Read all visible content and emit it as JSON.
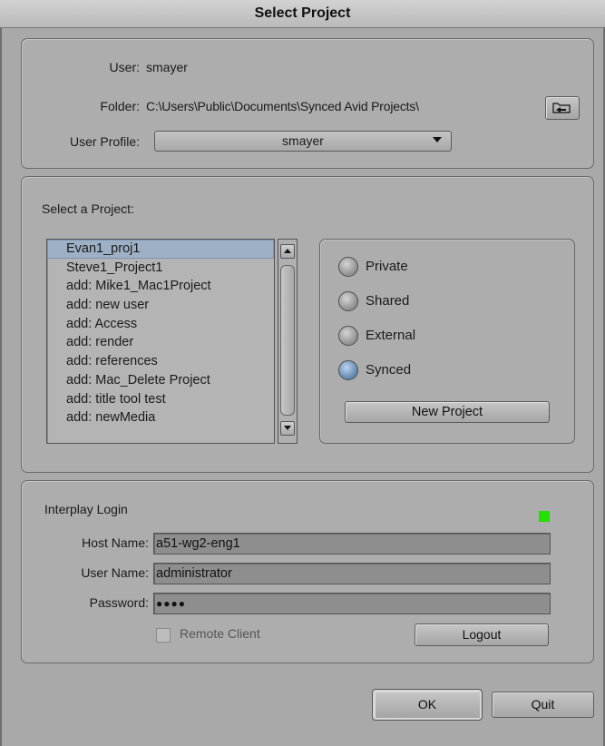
{
  "window": {
    "title": "Select Project"
  },
  "user_panel": {
    "user_label": "User:",
    "user_value": "smayer",
    "folder_label": "Folder:",
    "folder_value": "C:\\Users\\Public\\Documents\\Synced Avid Projects\\",
    "browse_icon": "folder-browse-icon",
    "profile_label": "User Profile:",
    "profile_value": "smayer"
  },
  "project_panel": {
    "select_label": "Select a Project:",
    "projects": [
      "Evan1_proj1",
      "Steve1_Project1",
      "add: Mike1_Mac1Project",
      "add: new user",
      "add: Access",
      "add: render",
      "add: references",
      "add: Mac_Delete Project",
      "add: title tool test",
      "add: newMedia"
    ],
    "selected_index": 0,
    "types": [
      {
        "label": "Private",
        "selected": false
      },
      {
        "label": "Shared",
        "selected": false
      },
      {
        "label": "External",
        "selected": false
      },
      {
        "label": "Synced",
        "selected": true
      }
    ],
    "new_project_label": "New Project"
  },
  "interplay": {
    "title": "Interplay Login",
    "status_color": "#22e000",
    "host_label": "Host Name:",
    "host_value": "a51-wg2-eng1",
    "user_label": "User Name:",
    "user_value": "administrator",
    "password_label": "Password:",
    "password_value": "●●●●",
    "remote_client_label": "Remote Client",
    "remote_client_checked": false,
    "logout_label": "Logout"
  },
  "footer": {
    "ok_label": "OK",
    "quit_label": "Quit"
  }
}
